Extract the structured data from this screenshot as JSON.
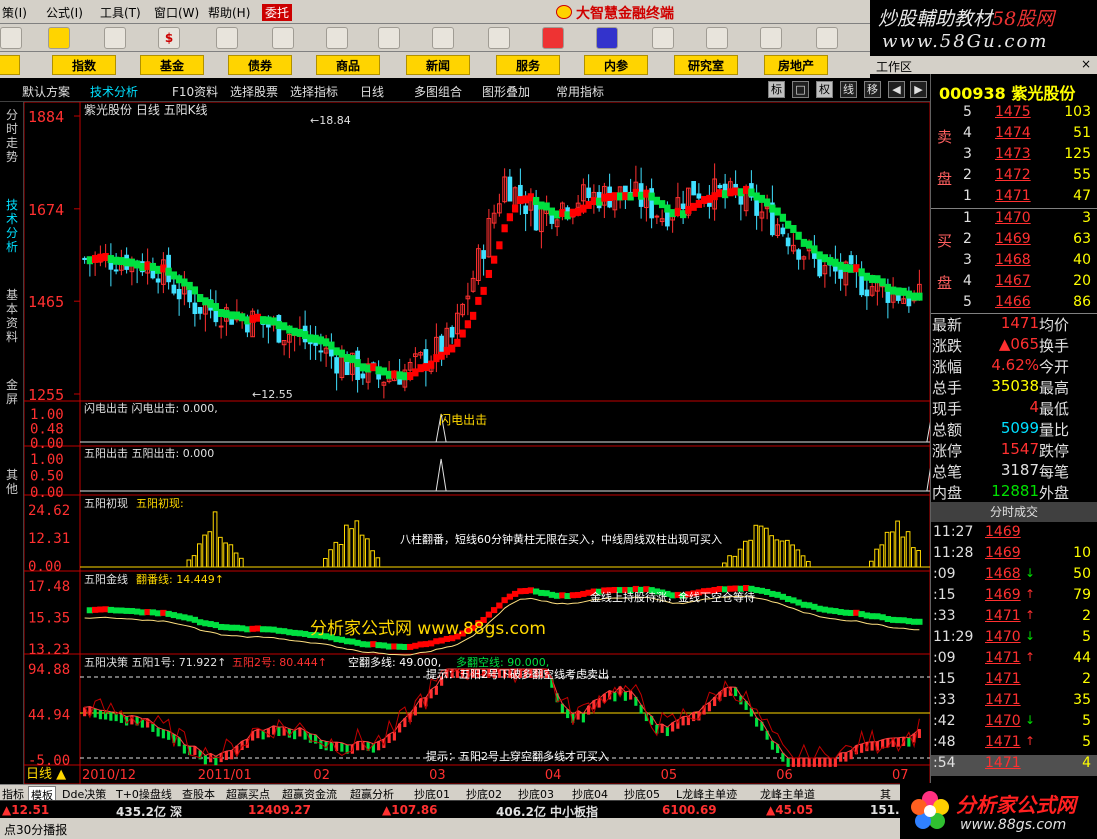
{
  "menu": {
    "items": [
      "策(I)",
      "公式(I)",
      "工具(T)",
      "窗口(W)",
      "帮助(H)"
    ],
    "hot": "委托",
    "brand": "大智慧金融终端"
  },
  "watermark": {
    "line1a": "炒股輔助教材",
    "line1b": "58股网",
    "line2": "www.58Gu.com"
  },
  "nav": [
    "指数",
    "基金",
    "债券",
    "商品",
    "新闻",
    "服务",
    "内参",
    "研究室",
    "房地产"
  ],
  "nav_left": "股",
  "subbar": {
    "items": [
      "默认方案",
      "技术分析",
      "F10资料",
      "选择股票",
      "选择指标",
      "日线",
      "多图组合",
      "图形叠加",
      "常用指标"
    ],
    "ctl": [
      "标",
      "□",
      "权",
      "线",
      "移"
    ]
  },
  "sidebar": [
    "分时走势",
    "技术分析",
    "基本资料",
    "金屏",
    "其他"
  ],
  "workzone": "工作区",
  "stock": {
    "code": "000938",
    "name": "紫光股份"
  },
  "sell": [
    {
      "lv": "5",
      "price": "1475",
      "vol": "103"
    },
    {
      "lv": "4",
      "price": "1474",
      "vol": "51"
    },
    {
      "lv": "3",
      "price": "1473",
      "vol": "125"
    },
    {
      "lv": "2",
      "price": "1472",
      "vol": "55"
    },
    {
      "lv": "1",
      "price": "1471",
      "vol": "47"
    }
  ],
  "buy": [
    {
      "lv": "1",
      "price": "1470",
      "vol": "3"
    },
    {
      "lv": "2",
      "price": "1469",
      "vol": "63"
    },
    {
      "lv": "3",
      "price": "1468",
      "vol": "40"
    },
    {
      "lv": "4",
      "price": "1467",
      "vol": "20"
    },
    {
      "lv": "5",
      "price": "1466",
      "vol": "86"
    }
  ],
  "sell_label": [
    "卖",
    "盘"
  ],
  "buy_label": [
    "买",
    "盘"
  ],
  "stats": [
    {
      "k": "最新",
      "v": "1471",
      "c": "#ff3030",
      "k2": "均价"
    },
    {
      "k": "涨跌",
      "v": "▲065",
      "c": "#ff3030",
      "k2": "换手"
    },
    {
      "k": "涨幅",
      "v": "4.62%",
      "c": "#ff3030",
      "k2": "今开"
    },
    {
      "k": "总手",
      "v": "35038",
      "c": "#ffff00",
      "k2": "最高"
    },
    {
      "k": "现手",
      "v": "4",
      "c": "#ff3030",
      "k2": "最低"
    },
    {
      "k": "总额",
      "v": "5099",
      "c": "#00e0ff",
      "k2": "量比"
    },
    {
      "k": "涨停",
      "v": "1547",
      "c": "#ff3030",
      "k2": "跌停"
    },
    {
      "k": "总笔",
      "v": "3187",
      "c": "#e0e0e0",
      "k2": "每笔"
    },
    {
      "k": "内盘",
      "v": "12881",
      "c": "#00e000",
      "k2": "外盘"
    }
  ],
  "ticks_header": "分时成交",
  "ticks": [
    {
      "t": "11:27",
      "p": "1469",
      "a": "",
      "ac": "",
      "v": ""
    },
    {
      "t": "11:28",
      "p": "1469",
      "a": "",
      "ac": "",
      "v": "10"
    },
    {
      "t": ":09",
      "p": "1468",
      "a": "↓",
      "ac": "#00e000",
      "v": "50"
    },
    {
      "t": ":15",
      "p": "1469",
      "a": "↑",
      "ac": "#ff3030",
      "v": "79"
    },
    {
      "t": ":33",
      "p": "1471",
      "a": "↑",
      "ac": "#ff3030",
      "v": "2"
    },
    {
      "t": "11:29",
      "p": "1470",
      "a": "↓",
      "ac": "#00e000",
      "v": "5"
    },
    {
      "t": ":09",
      "p": "1471",
      "a": "↑",
      "ac": "#ff3030",
      "v": "44"
    },
    {
      "t": ":15",
      "p": "1471",
      "a": "",
      "ac": "",
      "v": "2"
    },
    {
      "t": ":33",
      "p": "1471",
      "a": "",
      "ac": "",
      "v": "35"
    },
    {
      "t": ":42",
      "p": "1470",
      "a": "↓",
      "ac": "#00e000",
      "v": "5"
    },
    {
      "t": ":48",
      "p": "1471",
      "a": "↑",
      "ac": "#ff3030",
      "v": "5"
    },
    {
      "t": ":54",
      "p": "1471",
      "a": "",
      "ac": "",
      "v": "4"
    }
  ],
  "chart_data": {
    "type": "candlestick",
    "title": "紫光股份 日线 五阳K线",
    "y_ticks": [
      "1884",
      "1674",
      "1465",
      "1255"
    ],
    "ylim": [
      1255,
      1884
    ],
    "high_label": "18.84",
    "low_label": "12.55",
    "x_labels": [
      "2010/12",
      "2011/01",
      "02",
      "03",
      "04",
      "05",
      "06",
      "07"
    ],
    "period_label": "日线",
    "panels": [
      {
        "name": "闪电出击",
        "label": "闪电出击  闪电出击: 0.000,",
        "y_ticks": [
          "1.00",
          "0.48",
          "0.00"
        ],
        "signal": "闪电出击"
      },
      {
        "name": "五阳出击",
        "label": "五阳出击  五阳出击: 0.000",
        "y_ticks": [
          "1.00",
          "0.50",
          "0.00"
        ]
      },
      {
        "name": "五阳初现",
        "label": "五阳初现",
        "label2": "五阳初现:",
        "y_ticks": [
          "24.62",
          "12.31",
          "0.00"
        ],
        "note": "八柱翻番，短线60分钟黄柱无限在买入，中线周线双柱出现可买入"
      },
      {
        "name": "五阳金线",
        "label": "五阳金线",
        "label2": "翻番线: 14.449↑",
        "y_ticks": [
          "17.48",
          "15.35",
          "13.23"
        ],
        "note": "金线上持股待涨，金线下空仓等待",
        "watermark": "分析家公式网 www.88gs.com"
      },
      {
        "name": "五阳决策",
        "label": "五阳决策  五阳1号: 71.922↑",
        "label2": "五阳2号: 80.444↑",
        "label3": "空翻多线: 49.000,",
        "label4": "多翻空线: 90.000,",
        "y_ticks": [
          "94.88",
          "44.94",
          "-5.00"
        ],
        "hint1": "提示：五阳2号下破多翻空线考虑卖出",
        "hint2": "提示：五阳2号上穿空翻多线才可买入"
      }
    ]
  },
  "bottom_tabs": [
    "指标",
    "模板",
    "Dde决策",
    "T+0操盘线",
    "查股本",
    "超赢买点",
    "超赢资金流",
    "超赢分析",
    "抄底01",
    "抄底02",
    "抄底03",
    "抄底04",
    "抄底05",
    "L龙峰主单迹",
    "龙峰主单道",
    "其"
  ],
  "ticker": [
    {
      "t": "▲12.51",
      "c": "r"
    },
    {
      "t": "435.2亿",
      "c": "w"
    },
    {
      "t": "深",
      "c": "w"
    },
    {
      "t": "12409.27",
      "c": "r"
    },
    {
      "t": "▲107.86",
      "c": "r"
    },
    {
      "t": "406.2亿",
      "c": "w"
    },
    {
      "t": "中小板指",
      "c": "w"
    },
    {
      "t": "6100.69",
      "c": "r"
    },
    {
      "t": "▲45.05",
      "c": "r"
    },
    {
      "t": "151.",
      "c": "w"
    }
  ],
  "status": "点30分播报",
  "logo": {
    "t1": "分析家公式网",
    "t2": "www.88gs.com"
  }
}
